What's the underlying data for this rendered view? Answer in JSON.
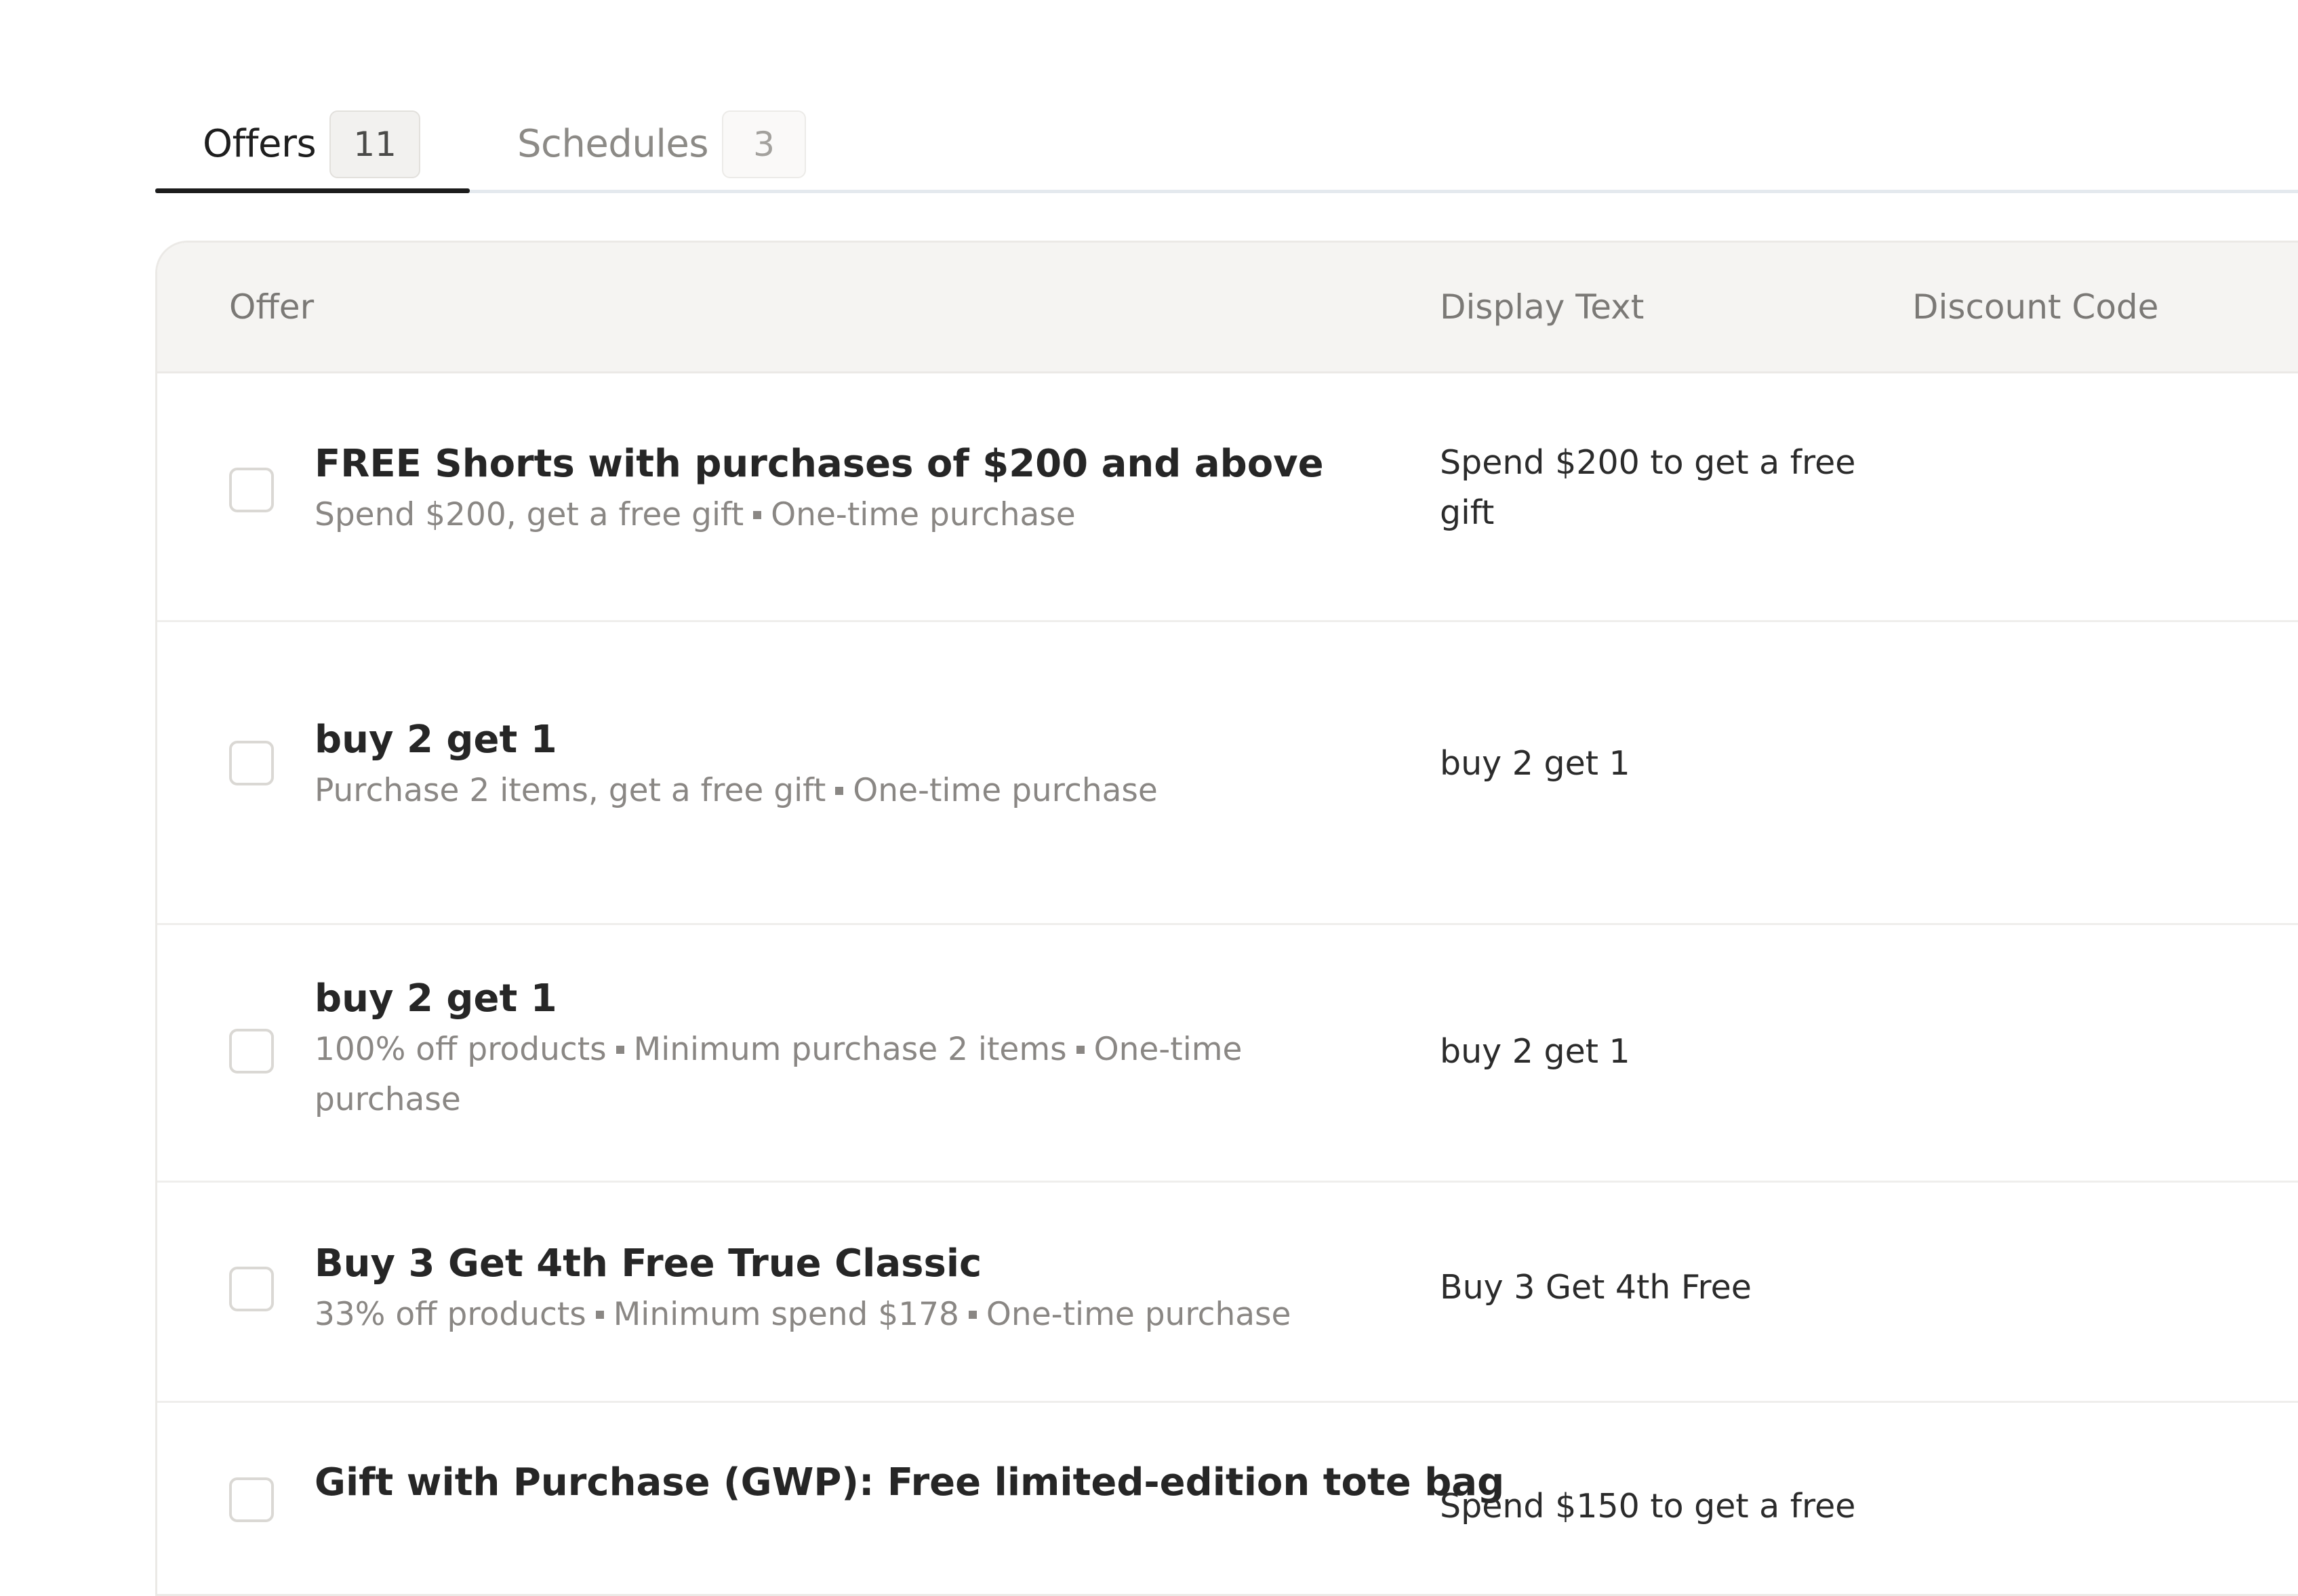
{
  "tabs": [
    {
      "label": "Offers",
      "count": "11",
      "active": true
    },
    {
      "label": "Schedules",
      "count": "3",
      "active": false
    }
  ],
  "table": {
    "columns": {
      "offer": "Offer",
      "display_text": "Display Text",
      "discount_code": "Discount Code"
    },
    "rows": [
      {
        "title": "FREE Shorts with purchases of $200 and above",
        "meta": [
          "Spend $200, get a free gift",
          "One-time purchase"
        ],
        "display_text": "Spend $200 to get a free gift",
        "discount_code": ""
      },
      {
        "title": "buy 2 get 1",
        "meta": [
          "Purchase 2 items, get a free gift",
          "One-time purchase"
        ],
        "display_text": "buy 2 get 1",
        "discount_code": ""
      },
      {
        "title": "buy 2 get 1",
        "meta": [
          "100% off products",
          "Minimum purchase 2 items",
          "One-time purchase"
        ],
        "display_text": "buy 2 get 1",
        "discount_code": ""
      },
      {
        "title": "Buy 3 Get 4th Free True Classic",
        "meta": [
          "33% off products",
          "Minimum spend $178",
          "One-time purchase"
        ],
        "display_text": "Buy 3 Get 4th Free",
        "discount_code": ""
      },
      {
        "title": "Gift with Purchase (GWP): Free limited-edition tote bag",
        "meta": [],
        "display_text": "Spend $150 to get a free",
        "discount_code": ""
      }
    ]
  }
}
